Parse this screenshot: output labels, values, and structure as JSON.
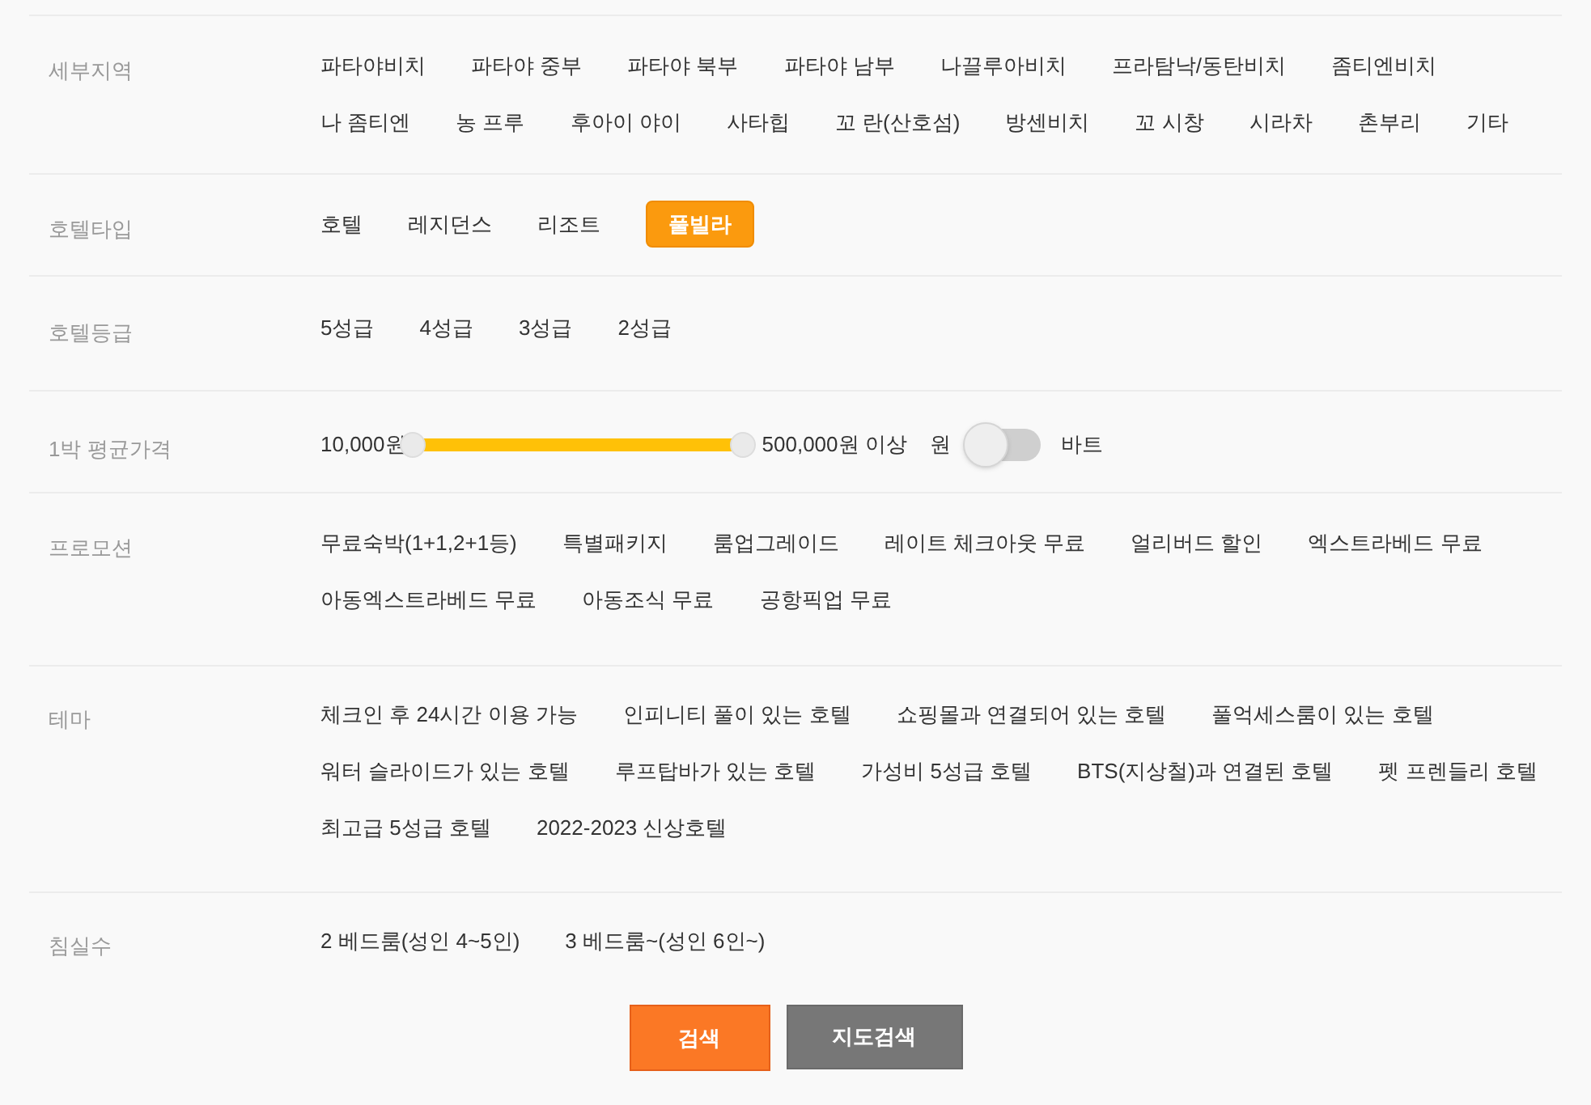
{
  "filters": [
    {
      "kind": "options",
      "label": "세부지역",
      "lines": [
        [
          {
            "label": "파타야비치",
            "selected": false
          },
          {
            "label": "파타야 중부",
            "selected": false
          },
          {
            "label": "파타야 북부",
            "selected": false
          },
          {
            "label": "파타야 남부",
            "selected": false
          },
          {
            "label": "나끌루아비치",
            "selected": false
          },
          {
            "label": "프라탐낙/동탄비치",
            "selected": false
          },
          {
            "label": "좀티엔비치",
            "selected": false
          }
        ],
        [
          {
            "label": "나 좀티엔",
            "selected": false
          },
          {
            "label": "농 프루",
            "selected": false
          },
          {
            "label": "후아이 야이",
            "selected": false
          },
          {
            "label": "사타힙",
            "selected": false
          },
          {
            "label": "꼬 란(산호섬)",
            "selected": false
          },
          {
            "label": "방센비치",
            "selected": false
          },
          {
            "label": "꼬 시창",
            "selected": false
          },
          {
            "label": "시라차",
            "selected": false
          },
          {
            "label": "촌부리",
            "selected": false
          },
          {
            "label": "기타",
            "selected": false
          }
        ]
      ]
    },
    {
      "kind": "options",
      "label": "호텔타입",
      "lines": [
        [
          {
            "label": "호텔",
            "selected": false
          },
          {
            "label": "레지던스",
            "selected": false
          },
          {
            "label": "리조트",
            "selected": false
          },
          {
            "label": "풀빌라",
            "selected": true
          }
        ]
      ]
    },
    {
      "kind": "options",
      "label": "호텔등급",
      "lines": [
        [
          {
            "label": "5성급",
            "selected": false
          },
          {
            "label": "4성급",
            "selected": false
          },
          {
            "label": "3성급",
            "selected": false
          },
          {
            "label": "2성급",
            "selected": false
          }
        ]
      ]
    },
    {
      "kind": "price",
      "label": "1박 평균가격",
      "min": "10,000원",
      "max": "500,000원 이상",
      "level": 1,
      "currency_left": "원",
      "currency_right": "바트",
      "currency_on": false
    },
    {
      "kind": "options",
      "label": "프로모션",
      "lines": [
        [
          {
            "label": "무료숙박(1+1,2+1등)",
            "selected": false
          },
          {
            "label": "특별패키지",
            "selected": false
          },
          {
            "label": "룸업그레이드",
            "selected": false
          },
          {
            "label": "레이트 체크아웃 무료",
            "selected": false
          },
          {
            "label": "얼리버드 할인",
            "selected": false
          },
          {
            "label": "엑스트라베드 무료",
            "selected": false
          }
        ],
        [
          {
            "label": "아동엑스트라베드 무료",
            "selected": false
          },
          {
            "label": "아동조식 무료",
            "selected": false
          },
          {
            "label": "공항픽업 무료",
            "selected": false
          }
        ]
      ]
    },
    {
      "kind": "options",
      "label": "테마",
      "lines": [
        [
          {
            "label": "체크인 후 24시간 이용 가능",
            "selected": false
          },
          {
            "label": "인피니티 풀이 있는 호텔",
            "selected": false
          },
          {
            "label": "쇼핑몰과 연결되어 있는 호텔",
            "selected": false
          },
          {
            "label": "풀억세스룸이 있는 호텔",
            "selected": false
          }
        ],
        [
          {
            "label": "워터 슬라이드가 있는 호텔",
            "selected": false
          },
          {
            "label": "루프탑바가 있는 호텔",
            "selected": false
          },
          {
            "label": "가성비 5성급 호텔",
            "selected": false
          },
          {
            "label": "BTS(지상철)과 연결된 호텔",
            "selected": false
          },
          {
            "label": "펫 프렌들리 호텔",
            "selected": false
          }
        ],
        [
          {
            "label": "최고급 5성급 호텔",
            "selected": false
          },
          {
            "label": "2022-2023 신상호텔",
            "selected": false
          }
        ]
      ]
    },
    {
      "kind": "options",
      "label": "침실수",
      "lines": [
        [
          {
            "label": "2 베드룸(성인 4~5인)",
            "selected": false
          },
          {
            "label": "3 베드룸~(성인 6인~)",
            "selected": false
          }
        ]
      ]
    }
  ],
  "buttons": [
    {
      "label": "검색",
      "kind": "primary"
    },
    {
      "label": "지도검색",
      "kind": "secondary"
    }
  ]
}
